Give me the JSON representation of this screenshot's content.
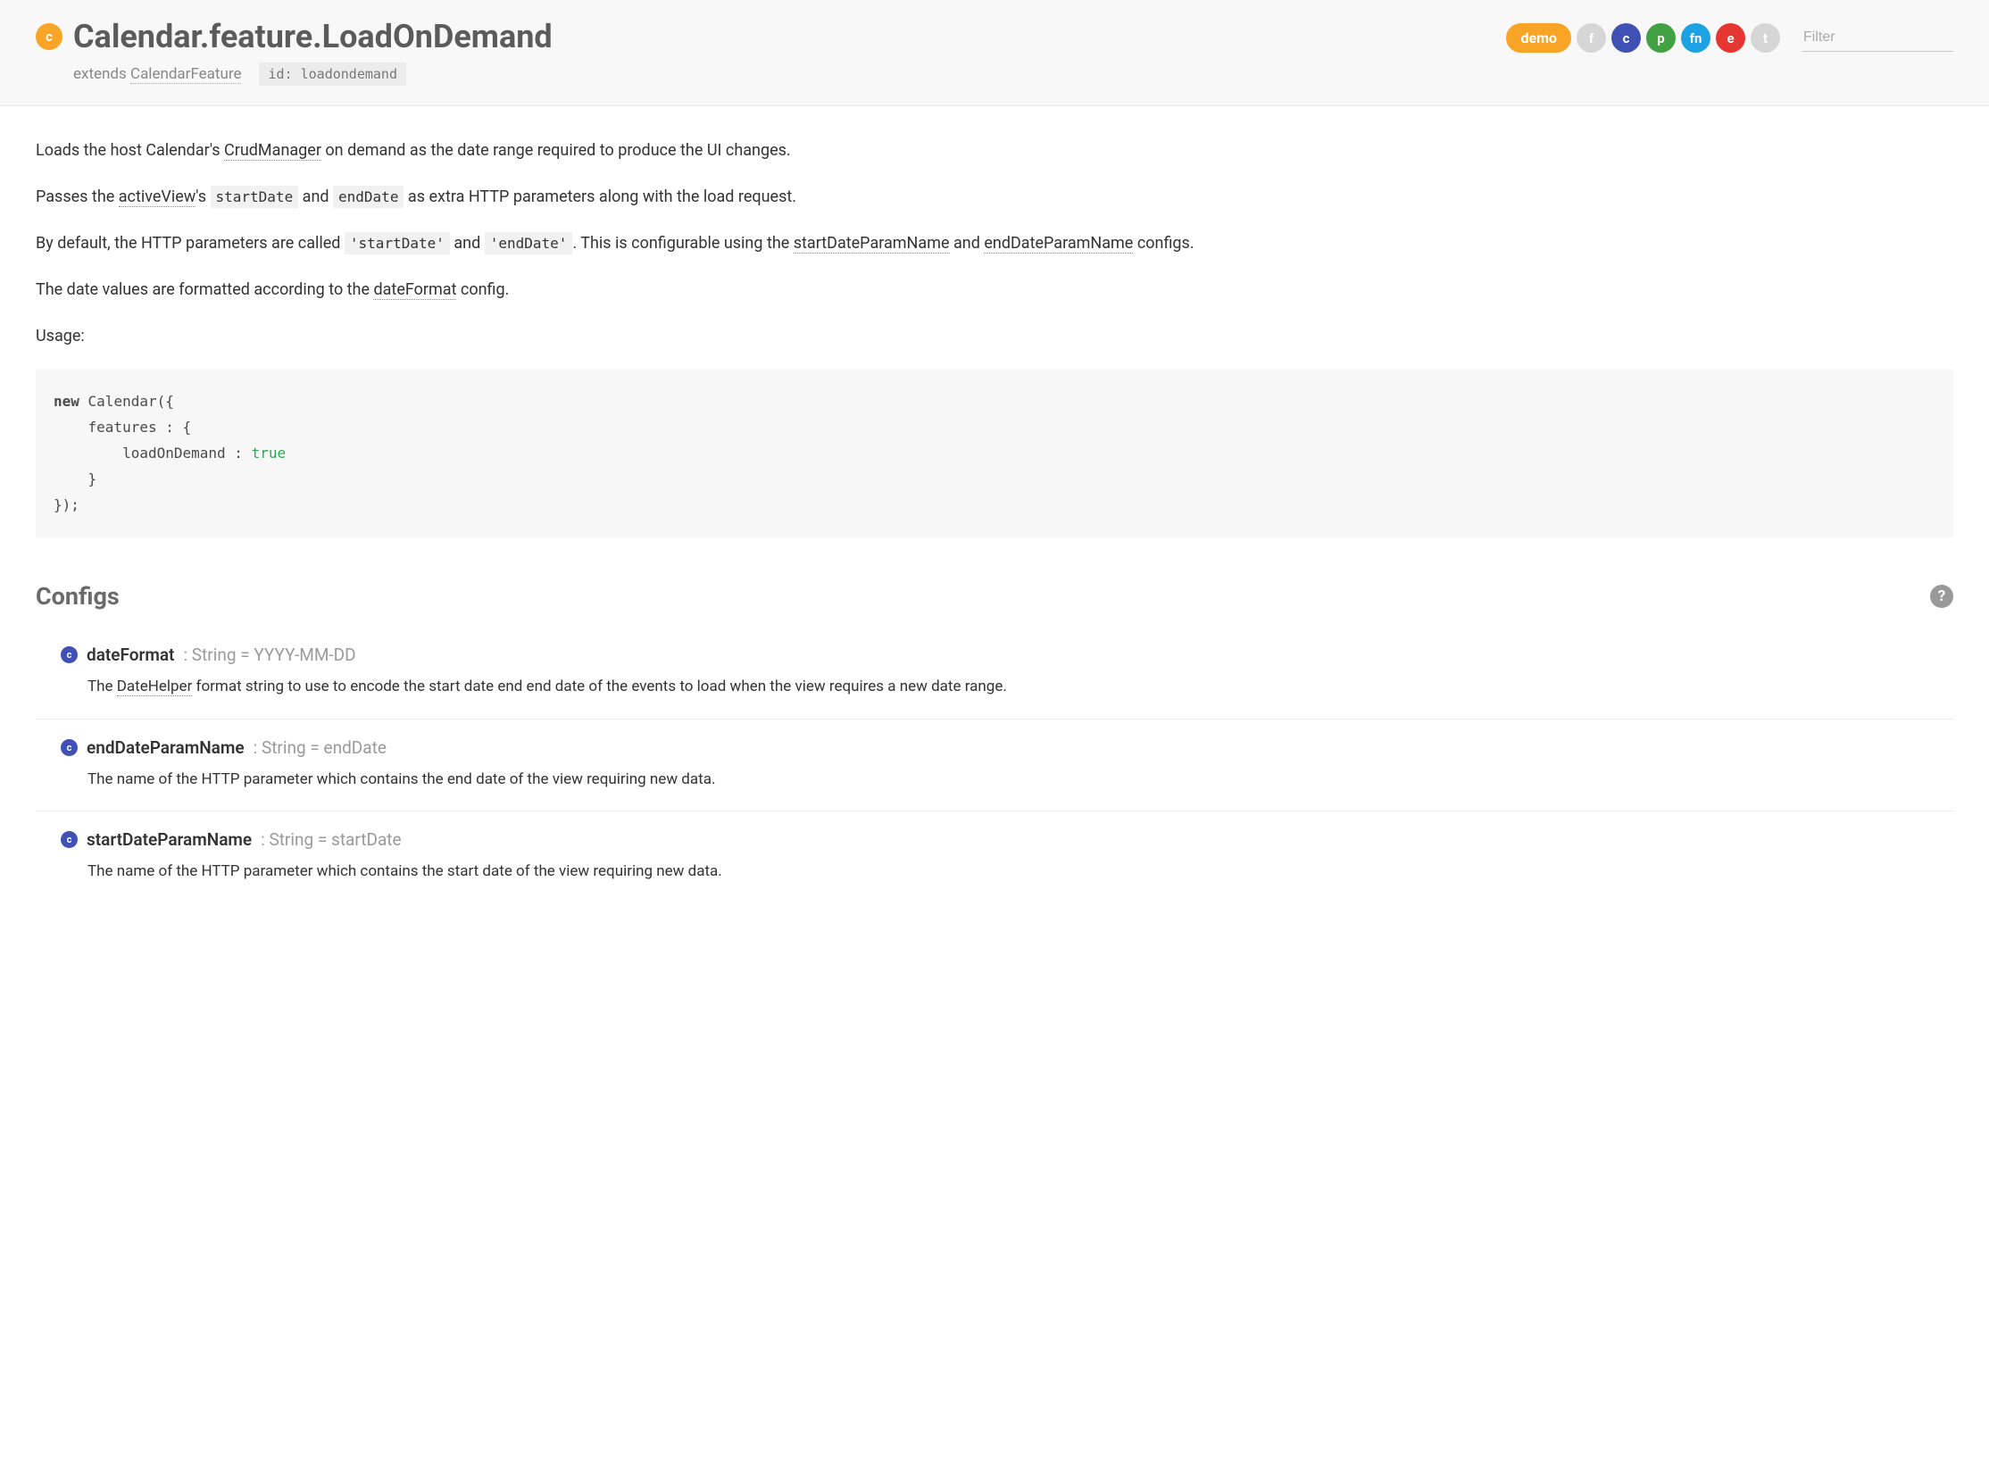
{
  "header": {
    "title": "Calendar.feature.LoadOnDemand",
    "extends_label": "extends ",
    "extends_link": "CalendarFeature",
    "id_label": "id: loadondemand",
    "class_icon": "c",
    "badges": {
      "demo": "demo",
      "f": "f",
      "c": "c",
      "p": "p",
      "fn": "fn",
      "e": "e",
      "t": "t"
    },
    "filter_placeholder": "Filter"
  },
  "description": {
    "para1_a": "Loads the host Calendar's ",
    "para1_link": "CrudManager",
    "para1_b": " on demand as the date range required to produce the UI changes.",
    "para2_a": "Passes the ",
    "para2_link": "activeView",
    "para2_b": "'s ",
    "para2_code1": "startDate",
    "para2_c": " and ",
    "para2_code2": "endDate",
    "para2_d": " as extra HTTP parameters along with the load request.",
    "para3_a": "By default, the HTTP parameters are called ",
    "para3_code1": "'startDate'",
    "para3_b": " and ",
    "para3_code2": "'endDate'",
    "para3_c": ". This is configurable using the ",
    "para3_link1": "startDateParamName",
    "para3_d": " and ",
    "para3_link2": "endDateParamName",
    "para3_e": " configs.",
    "para4_a": "The date values are formatted according to the ",
    "para4_link": "dateFormat",
    "para4_b": " config.",
    "para5": "Usage:"
  },
  "code": {
    "line1_kw": "new",
    "line1_rest": " Calendar({",
    "line2": "    features : {",
    "line3_a": "        loadOnDemand : ",
    "line3_bool": "true",
    "line4": "    }",
    "line5": "});"
  },
  "configs_section": {
    "title": "Configs",
    "help": "?"
  },
  "configs": [
    {
      "badge": "c",
      "name": "dateFormat",
      "type_sig": " : String = YYYY-MM-DD",
      "desc_a": "The ",
      "desc_link": "DateHelper",
      "desc_b": " format string to use to encode the start date end end date of the events to load when the view requires a new date range."
    },
    {
      "badge": "c",
      "name": "endDateParamName",
      "type_sig": " : String = endDate",
      "desc_a": "The name of the HTTP parameter which contains the end date of the view requiring new data.",
      "desc_link": "",
      "desc_b": ""
    },
    {
      "badge": "c",
      "name": "startDateParamName",
      "type_sig": " : String = startDate",
      "desc_a": "The name of the HTTP parameter which contains the start date of the view requiring new data.",
      "desc_link": "",
      "desc_b": ""
    }
  ]
}
